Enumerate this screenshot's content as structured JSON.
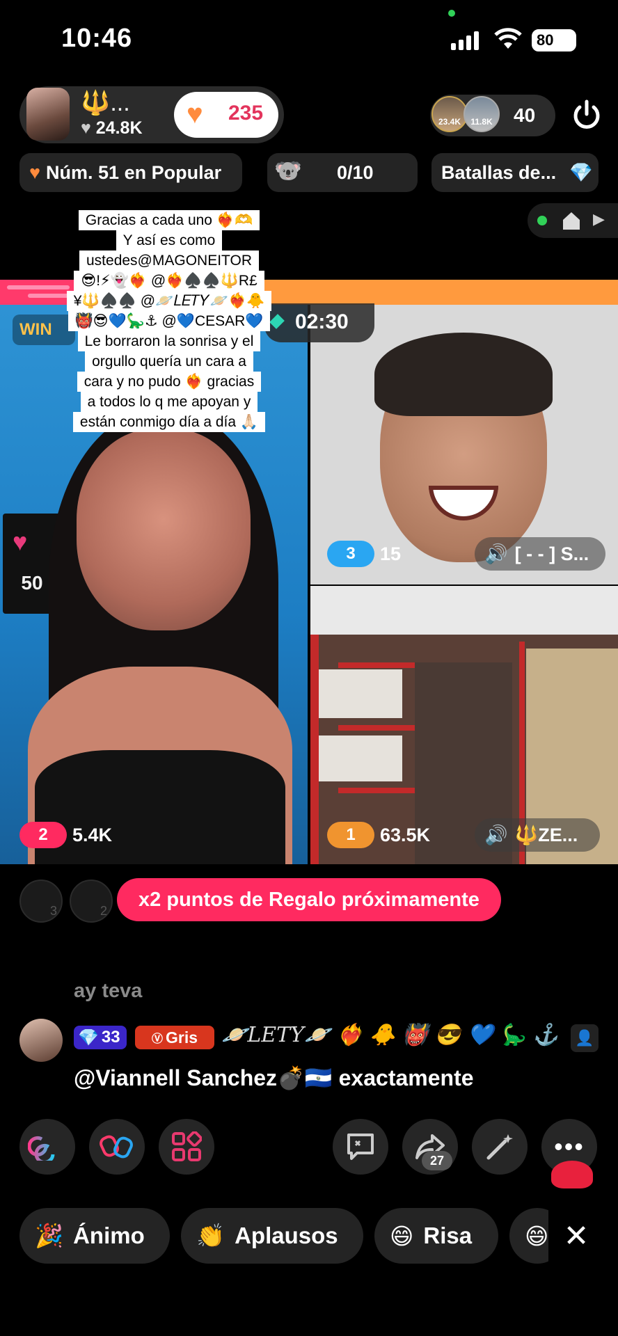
{
  "status_bar": {
    "time": "10:46",
    "battery": "80"
  },
  "host": {
    "name_icon": "🔱",
    "name_suffix": "...",
    "likes": "24.8K",
    "heart_count": "235"
  },
  "viewers": {
    "avatar1_label": "23.4K",
    "avatar2_label": "11.8K",
    "count": "40"
  },
  "chips": {
    "rank": "Núm. 51 en Popular",
    "bear_progress": "0/10",
    "battles": "Batallas de..."
  },
  "pinned_note": {
    "lines": [
      "Gracias a cada uno ❤️‍🔥🫶",
      "Y así es como",
      "ustedes@MAGONEITOR",
      "😎!⚡👻❤️‍🔥 @❤️‍🔥♠️♠️🔱R£",
      "¥🔱♠️♠️ @🪐𝐿𝐸𝑇𝑌🪐❤️‍🔥🐥",
      "👹😎💙🦕⚓ @💙CESAR💙",
      "Le borraron la sonrisa y el",
      "orgullo quería un cara a",
      "cara y no pudo ❤️‍🔥 gracias",
      "a todos lo q me apoyan y",
      "están conmigo día a día 🙏🏻"
    ]
  },
  "battle": {
    "win_label": "WIN",
    "timer": "02:30",
    "left": {
      "rank": "2",
      "score": "5.4K",
      "poster_text": "50"
    },
    "top_right": {
      "rank": "3",
      "score": "15",
      "name": "[ - - ] S..."
    },
    "bottom_right": {
      "rank": "1",
      "score": "63.5K",
      "name": "🔱ZE..."
    }
  },
  "gift_banner": {
    "text": "x2 puntos de Regalo próximamente",
    "avatar_digits": [
      "3",
      "2"
    ]
  },
  "chat": {
    "faded_comment": "ay teva",
    "comment": {
      "level": "33",
      "badge": "Gris",
      "username": "🪐𝐿𝐸𝑇𝑌🪐 ❤️‍🔥 🐥 👹 😎 💙 🦕 ⚓",
      "text": "@Viannell Sanchez💣🇸🇻 exactamente"
    }
  },
  "actions": {
    "share_count": "27"
  },
  "quick_reactions": [
    "Ánimo",
    "Aplausos",
    "Risa"
  ],
  "colors": {
    "accent_pink": "#ff2a60",
    "heart_orange": "#ff8b3d",
    "rank_blue": "#2aa6f2",
    "rank_orange": "#f0942f"
  }
}
